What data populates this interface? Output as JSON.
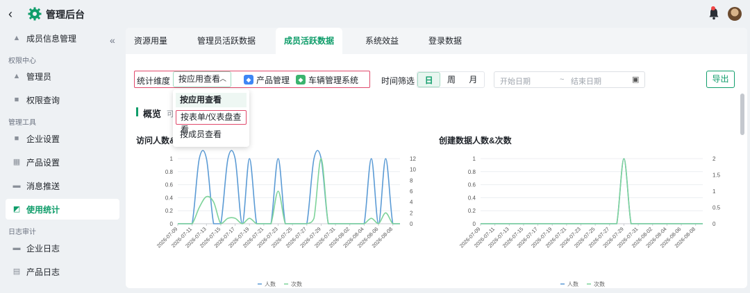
{
  "header": {
    "back_icon": "chevron-left-icon",
    "title": "管理后台",
    "logo_icon": "gear-icon",
    "accent": "#0f9d6a"
  },
  "sidebar": {
    "items": [
      {
        "label": "成员信息管理",
        "icon": "user-card-icon"
      },
      {
        "group": "权限中心"
      },
      {
        "label": "管理员",
        "icon": "admin-icon"
      },
      {
        "label": "权限查询",
        "icon": "lock-icon"
      },
      {
        "group": "管理工具"
      },
      {
        "label": "企业设置",
        "icon": "building-icon"
      },
      {
        "label": "产品设置",
        "icon": "grid-icon"
      },
      {
        "label": "消息推送",
        "icon": "mail-icon"
      },
      {
        "label": "使用统计",
        "icon": "chart-icon",
        "active": true
      },
      {
        "group": "日志审计"
      },
      {
        "label": "企业日志",
        "icon": "log-icon"
      },
      {
        "label": "产品日志",
        "icon": "calendar-icon"
      }
    ]
  },
  "tabs": [
    "资源用量",
    "管理员活跃数据",
    "成员活跃数据",
    "系统效益",
    "登录数据"
  ],
  "active_tab": "成员活跃数据",
  "filters": {
    "dimension_label": "统计维度",
    "dimension_value": "按应用查看",
    "apps": [
      "产品管理",
      "车辆管理系统"
    ],
    "time_label": "时间筛选",
    "periods": [
      "日",
      "周",
      "月"
    ],
    "active_period": "日",
    "start_placeholder": "开始日期",
    "separator": "~",
    "end_placeholder": "结束日期",
    "export_label": "导出"
  },
  "dropdown": {
    "options": [
      "按应用查看",
      "按表单/仪表盘查看",
      "按成员查看"
    ],
    "selected": "按应用查看",
    "highlighted": "按表单/仪表盘查看"
  },
  "overview": {
    "title": "概览",
    "subtitle": "可"
  },
  "chart_data": [
    {
      "type": "line",
      "title": "访问人数&",
      "x": [
        "2026-07-09",
        "2026-07-10",
        "2026-07-11",
        "2026-07-12",
        "2026-07-13",
        "2026-07-14",
        "2026-07-15",
        "2026-07-16",
        "2026-07-17",
        "2026-07-18",
        "2026-07-19",
        "2026-07-20",
        "2026-07-21",
        "2026-07-22",
        "2026-07-23",
        "2026-07-24",
        "2026-07-25",
        "2026-07-26",
        "2026-07-27",
        "2026-07-28",
        "2026-07-29",
        "2026-07-30",
        "2026-07-31",
        "2026-08-01",
        "2026-08-02",
        "2026-08-03",
        "2026-08-04",
        "2026-08-05",
        "2026-08-06",
        "2026-08-07",
        "2026-08-08",
        "2026-08-09"
      ],
      "x_tick_labels": [
        "2026-07-09",
        "2026-07-11",
        "2026-07-13",
        "2026-07-15",
        "2026-07-17",
        "2026-07-19",
        "2026-07-21",
        "2026-07-23",
        "2026-07-25",
        "2026-07-27",
        "2026-07-29",
        "2026-07-31",
        "2026-08-02",
        "2026-08-04",
        "2026-08-06",
        "2026-08-08"
      ],
      "series": [
        {
          "name": "人数",
          "axis": "left",
          "color": "#5b9bd5",
          "values": [
            0,
            0,
            0,
            1,
            1,
            0,
            0,
            1,
            1,
            0,
            1,
            0,
            0,
            0,
            1,
            0,
            0,
            0,
            0,
            1,
            1,
            0,
            0,
            0,
            0,
            0,
            0,
            1,
            0,
            1,
            0,
            0
          ]
        },
        {
          "name": "次数",
          "axis": "right",
          "color": "#7ed39a",
          "values": [
            0,
            0,
            0,
            3,
            5,
            4,
            0,
            1,
            1,
            0,
            1,
            0,
            0,
            0,
            6,
            0,
            0,
            0,
            0,
            1,
            12,
            0,
            0,
            0,
            0,
            0,
            0,
            1,
            0,
            2,
            0,
            0
          ]
        }
      ],
      "y_left": {
        "range": [
          0,
          1
        ],
        "ticks": [
          0,
          0.2,
          0.4,
          0.6,
          0.8,
          1
        ]
      },
      "y_right": {
        "range": [
          0,
          12
        ],
        "ticks": [
          0,
          2,
          4,
          6,
          8,
          10,
          12
        ]
      },
      "legend": "bottom",
      "grid": true
    },
    {
      "type": "line",
      "title": "创建数据人数&次数",
      "x": [
        "2026-07-09",
        "2026-07-10",
        "2026-07-11",
        "2026-07-12",
        "2026-07-13",
        "2026-07-14",
        "2026-07-15",
        "2026-07-16",
        "2026-07-17",
        "2026-07-18",
        "2026-07-19",
        "2026-07-20",
        "2026-07-21",
        "2026-07-22",
        "2026-07-23",
        "2026-07-24",
        "2026-07-25",
        "2026-07-26",
        "2026-07-27",
        "2026-07-28",
        "2026-07-29",
        "2026-07-30",
        "2026-07-31",
        "2026-08-01",
        "2026-08-02",
        "2026-08-03",
        "2026-08-04",
        "2026-08-05",
        "2026-08-06",
        "2026-08-07",
        "2026-08-08",
        "2026-08-09"
      ],
      "x_tick_labels": [
        "2026-07-09",
        "2026-07-11",
        "2026-07-13",
        "2026-07-15",
        "2026-07-17",
        "2026-07-19",
        "2026-07-21",
        "2026-07-23",
        "2026-07-25",
        "2026-07-27",
        "2026-07-29",
        "2026-07-31",
        "2026-08-02",
        "2026-08-04",
        "2026-08-06",
        "2026-08-08"
      ],
      "series": [
        {
          "name": "人数",
          "axis": "left",
          "color": "#5b9bd5",
          "values": [
            0,
            0,
            0,
            0,
            0,
            0,
            0,
            0,
            0,
            0,
            0,
            0,
            0,
            0,
            0,
            0,
            0,
            0,
            0,
            0,
            1,
            0,
            0,
            0,
            0,
            0,
            0,
            0,
            0,
            0,
            0,
            0
          ]
        },
        {
          "name": "次数",
          "axis": "right",
          "color": "#7ed39a",
          "values": [
            0,
            0,
            0,
            0,
            0,
            0,
            0,
            0,
            0,
            0,
            0,
            0,
            0,
            0,
            0,
            0,
            0,
            0,
            0,
            0,
            2,
            0,
            0,
            0,
            0,
            0,
            0,
            0,
            0,
            0,
            0,
            0
          ]
        }
      ],
      "y_left": {
        "range": [
          0,
          1
        ],
        "ticks": [
          0,
          0.2,
          0.4,
          0.6,
          0.8,
          1
        ]
      },
      "y_right": {
        "range": [
          0,
          2
        ],
        "ticks": [
          0,
          0.5,
          1,
          1.5,
          2
        ]
      },
      "legend": "bottom",
      "grid": true
    }
  ]
}
